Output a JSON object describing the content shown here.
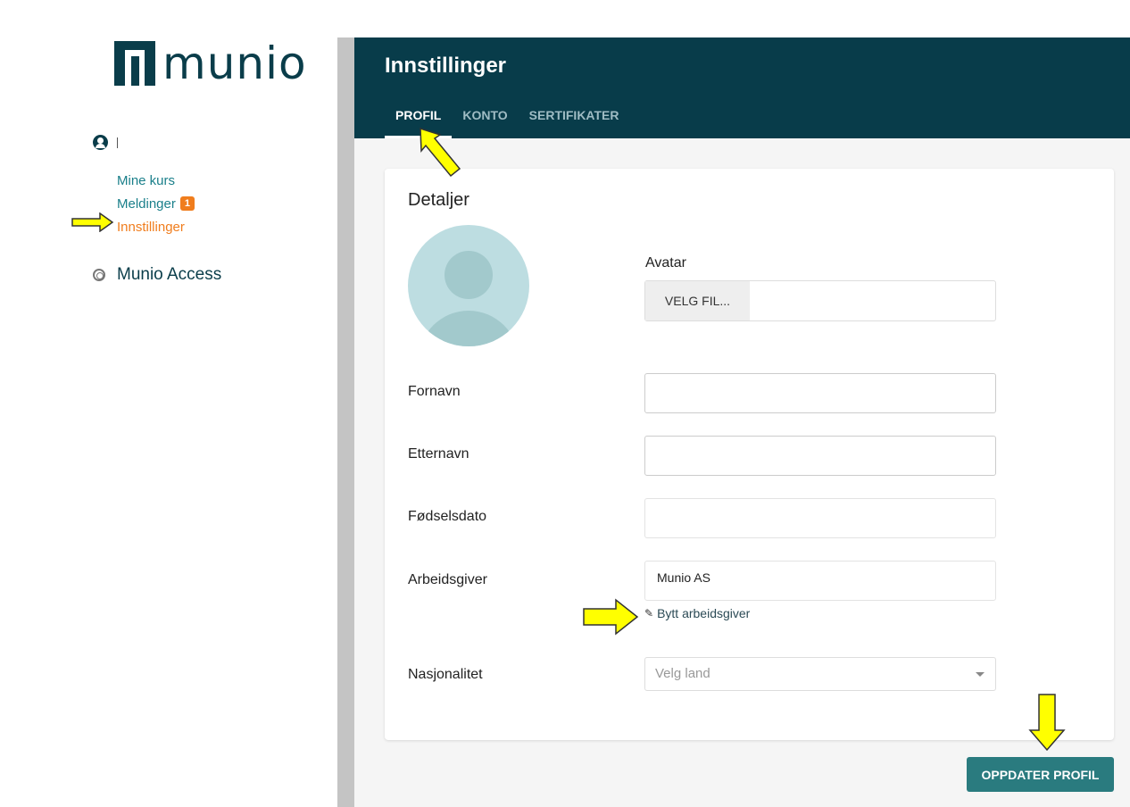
{
  "sidebar": {
    "logo_text": "munio",
    "user_icon": "user-circle-icon",
    "nav": [
      {
        "label": "Mine kurs"
      },
      {
        "label": "Meldinger",
        "badge": "1"
      },
      {
        "label": "Innstillinger",
        "active": true
      }
    ],
    "access_label": "Munio Access",
    "access_icon": "fingerprint-icon"
  },
  "header": {
    "title": "Innstillinger",
    "tabs": [
      {
        "label": "PROFIL",
        "active": true
      },
      {
        "label": "KONTO"
      },
      {
        "label": "SERTIFIKATER"
      }
    ]
  },
  "card": {
    "title": "Detaljer",
    "avatar_label": "Avatar",
    "file_button": "VELG FIL...",
    "fields": {
      "first_name": {
        "label": "Fornavn",
        "value": ""
      },
      "last_name": {
        "label": "Etternavn",
        "value": ""
      },
      "birthdate": {
        "label": "Fødselsdato",
        "value": ""
      },
      "employer": {
        "label": "Arbeidsgiver",
        "value": "Munio AS"
      },
      "nationality": {
        "label": "Nasjonalitet",
        "placeholder": "Velg land"
      }
    },
    "change_employer": "Bytt arbeidsgiver"
  },
  "actions": {
    "update_label": "OPPDATER PROFIL"
  },
  "colors": {
    "header_bg": "#083c4a",
    "accent_orange": "#f07d1d",
    "link_teal": "#1a7f8a",
    "button_teal": "#2a7b7f",
    "highlight_arrow": "#ffff00"
  }
}
